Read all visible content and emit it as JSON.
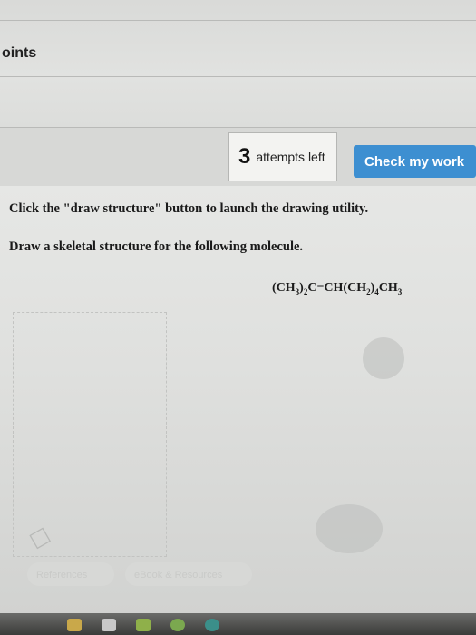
{
  "header": {
    "points_label": "oints"
  },
  "attempts": {
    "count": "3",
    "label": "attempts left"
  },
  "actions": {
    "check_label": "Check my work"
  },
  "question": {
    "instruction_1": "Click the \"draw structure\" button to launch the drawing utility.",
    "instruction_2": "Draw a skeletal structure for the following molecule."
  },
  "footer": {
    "references_label": "References",
    "ebook_label": "eBook & Resources"
  },
  "colors": {
    "button": "#3d8fd1",
    "page": "#d7d8d6"
  }
}
